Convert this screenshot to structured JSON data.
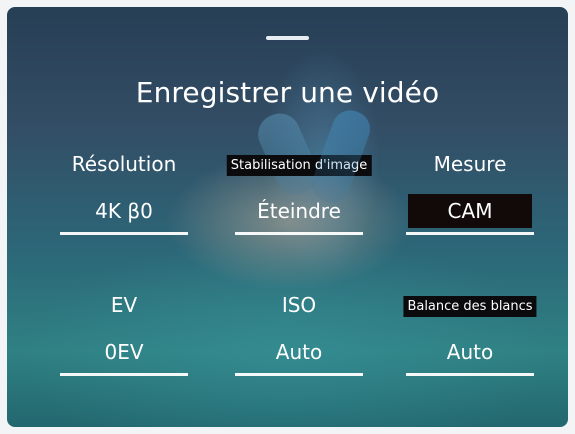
{
  "screen": {
    "title": "Enregistrer une vidéo"
  },
  "settings": {
    "resolution": {
      "label": "Résolution",
      "value": "4K  β0"
    },
    "stabilization": {
      "label": "Stabilisation d'image",
      "value": "Éteindre"
    },
    "metering": {
      "label": "Mesure",
      "value": "CAM"
    },
    "ev": {
      "label": "EV",
      "value": "0EV"
    },
    "iso": {
      "label": "ISO",
      "value": "Auto"
    },
    "white_balance": {
      "label": "Balance des blancs",
      "value": "Auto"
    }
  },
  "colors": {
    "text": "#ffffff",
    "label_background": "#0b0b0d",
    "selected_value_background": "#120909",
    "sea": "#2f8183"
  }
}
